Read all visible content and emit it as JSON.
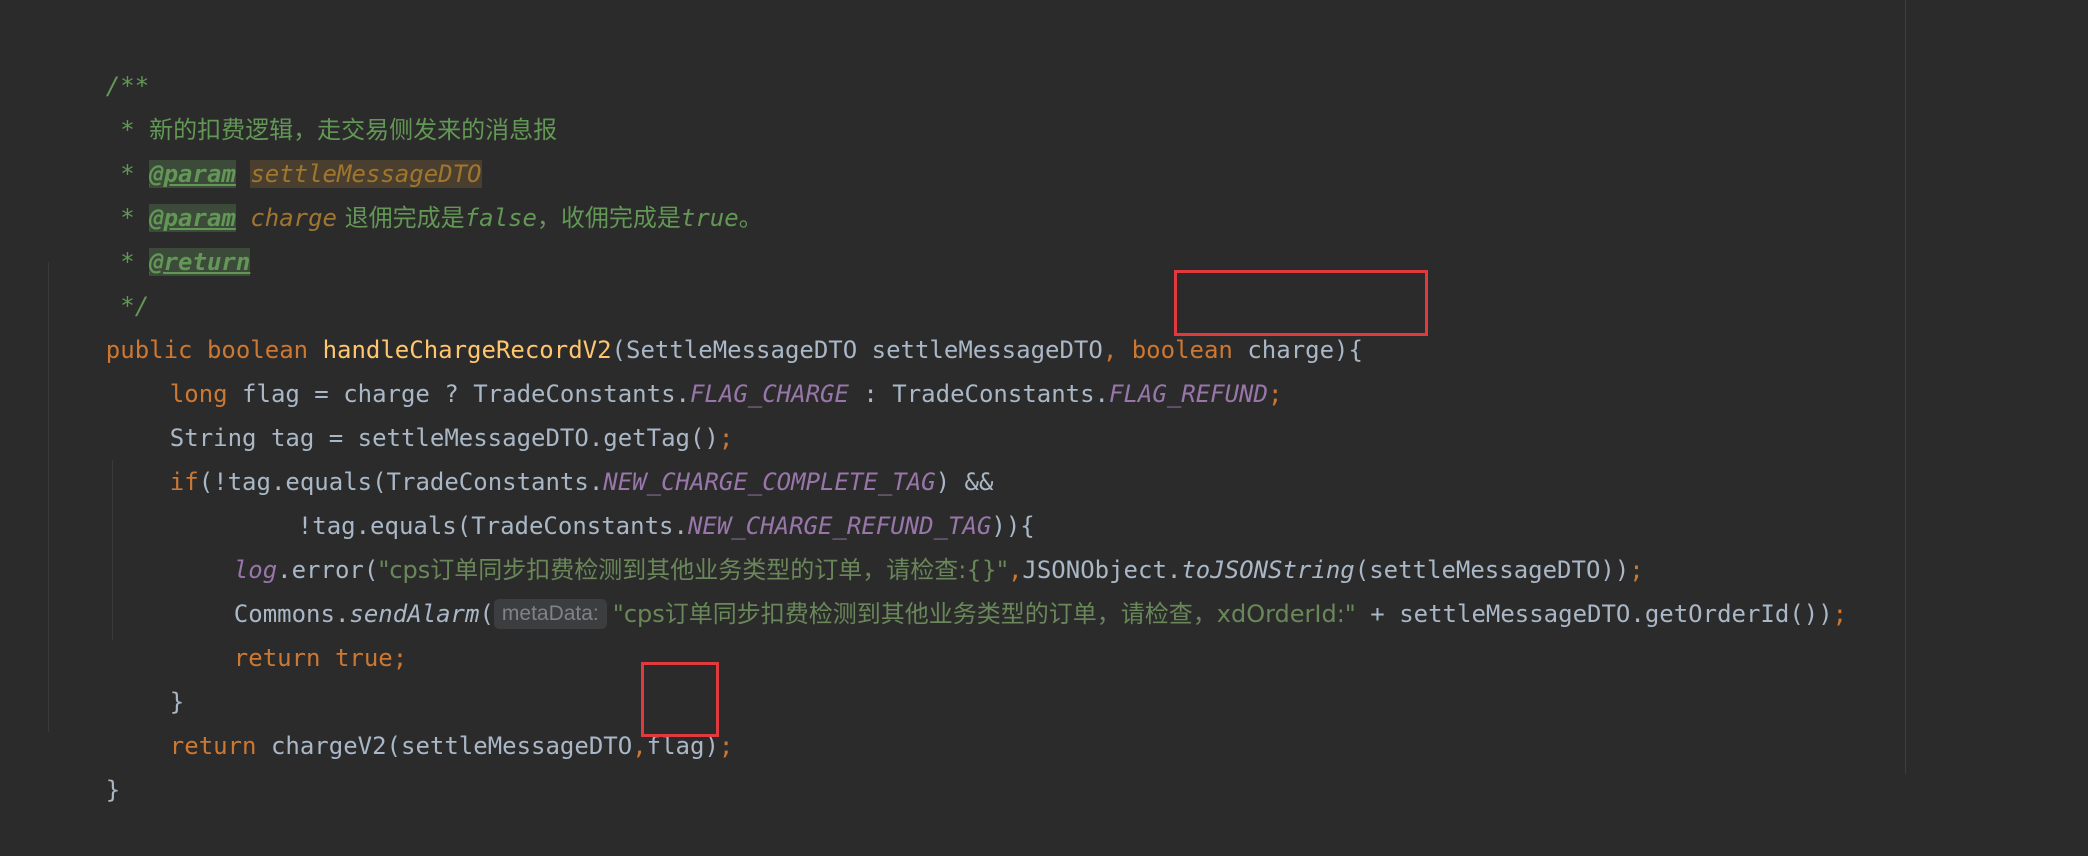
{
  "code": {
    "line1": "/**",
    "line2_prefix": " * ",
    "line2_text": "新的扣费逻辑，走交易侧发来的消息报",
    "line3_prefix": " * ",
    "line3_tag": "@param",
    "line3_sp": " ",
    "line3_param": "settleMessageDTO",
    "line4_prefix": " * ",
    "line4_tag": "@param",
    "line4_sp": " ",
    "line4_param": "charge",
    "line4_text1": " 退佣完成是",
    "line4_false": "false",
    "line4_text2": "，收佣完成是",
    "line4_true": "true",
    "line4_text3": "。",
    "line5_prefix": " * ",
    "line5_tag": "@return",
    "line6": " */",
    "line7_kw1": "public",
    "line7_sp1": " ",
    "line7_kw2": "boolean",
    "line7_sp2": " ",
    "line7_method": "handleChargeRecordV2",
    "line7_args1": "(SettleMessageDTO settleMessageDTO",
    "line7_comma": ",",
    "line7_sp3": " ",
    "line7_kw3": "boolean",
    "line7_args2": " charge){",
    "line8_kw": "long",
    "line8_a": " flag = charge ? TradeConstants.",
    "line8_c1": "FLAG_CHARGE",
    "line8_b": " : TradeConstants.",
    "line8_c2": "FLAG_REFUND",
    "line8_semi": ";",
    "line9_a": "String tag = settleMessageDTO.getTag()",
    "line9_semi": ";",
    "line10_kw": "if",
    "line10_a": "(!tag.equals(TradeConstants.",
    "line10_c": "NEW_CHARGE_COMPLETE_TAG",
    "line10_b": ") &&",
    "line11_a": "!tag.equals(TradeConstants.",
    "line11_c": "NEW_CHARGE_REFUND_TAG",
    "line11_b": ")){",
    "line12_log": "log",
    "line12_a": ".error(",
    "line12_str": "\"cps订单同步扣费检测到其他业务类型的订单，请检查:{}\"",
    "line12_comma": ",",
    "line12_b": "JSONObject.",
    "line12_m": "toJSONString",
    "line12_c": "(settleMessageDTO))",
    "line12_semi": ";",
    "line13_a": "Commons.",
    "line13_m": "sendAlarm",
    "line13_paren": "(",
    "line13_hint": "metaData:",
    "line13_str": "\"cps订单同步扣费检测到其他业务类型的订单，请检查，xdOrderId:\"",
    "line13_b": " + settleMessageDTO.getOrderId())",
    "line13_semi": ";",
    "line14_kw1": "return",
    "line14_sp": " ",
    "line14_kw2": "true",
    "line14_semi": ";",
    "line15": "}",
    "line16_kw": "return",
    "line16_a": " chargeV2(settleMessageDTO",
    "line16_comma": ",",
    "line16_b": "flag)",
    "line16_semi": ";",
    "line17": "}"
  },
  "colors": {
    "background": "#2b2b2b",
    "keyword": "#cc7832",
    "method": "#ffc66d",
    "constant": "#9876aa",
    "string": "#6a8759",
    "doc": "#629755",
    "highlight_box": "#e0393e"
  }
}
